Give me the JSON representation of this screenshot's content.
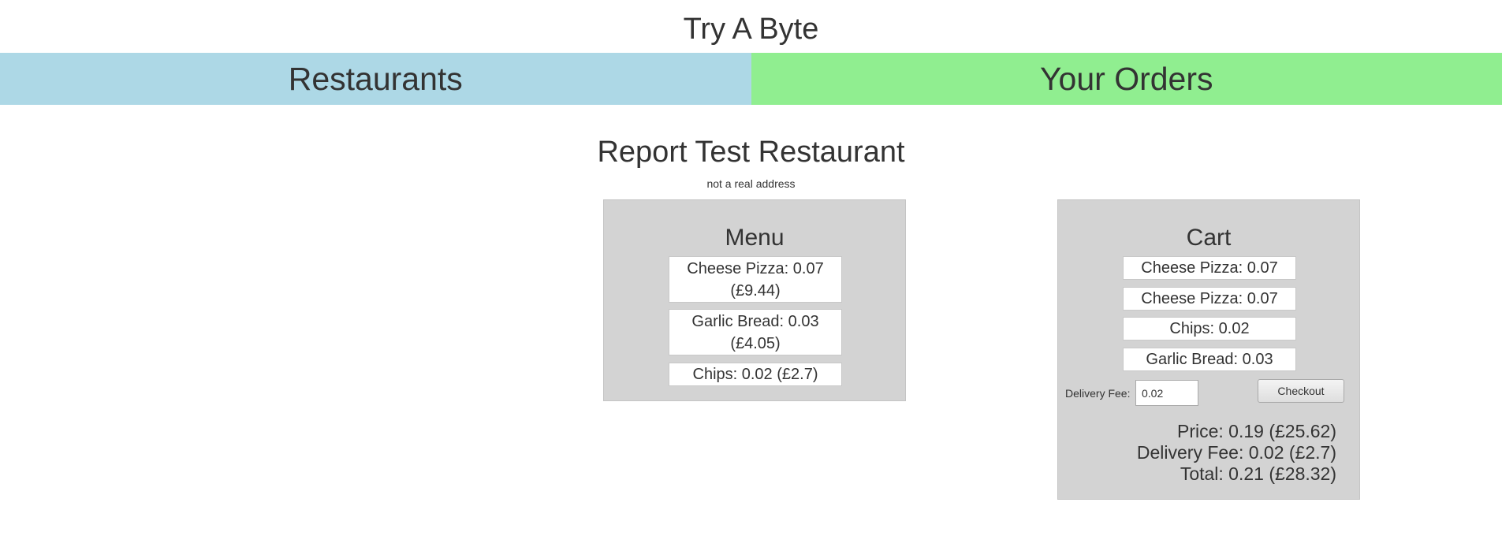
{
  "app": {
    "title": "Try A Byte"
  },
  "nav": {
    "tabs": [
      {
        "label": "Restaurants",
        "color": "#add8e6"
      },
      {
        "label": "Your Orders",
        "color": "#90ee90"
      }
    ]
  },
  "restaurant": {
    "name": "Report Test Restaurant",
    "address": "not a real address"
  },
  "menu": {
    "title": "Menu",
    "items": [
      {
        "label": "Cheese Pizza: 0.07 (£9.44)"
      },
      {
        "label": "Garlic Bread: 0.03 (£4.05)"
      },
      {
        "label": "Chips: 0.02 (£2.7)"
      }
    ]
  },
  "cart": {
    "title": "Cart",
    "items": [
      {
        "label": "Cheese Pizza: 0.07"
      },
      {
        "label": "Cheese Pizza: 0.07"
      },
      {
        "label": "Chips: 0.02"
      },
      {
        "label": "Garlic Bread: 0.03"
      }
    ],
    "delivery_fee_label": "Delivery Fee:",
    "delivery_fee_value": "0.02",
    "checkout_label": "Checkout",
    "price_line": "Price: 0.19 (£25.62)",
    "delivery_line": "Delivery Fee: 0.02 (£2.7)",
    "total_line": "Total: 0.21 (£28.32)"
  },
  "colors": {
    "panel_background": "#d3d3d3",
    "text": "#333333"
  }
}
